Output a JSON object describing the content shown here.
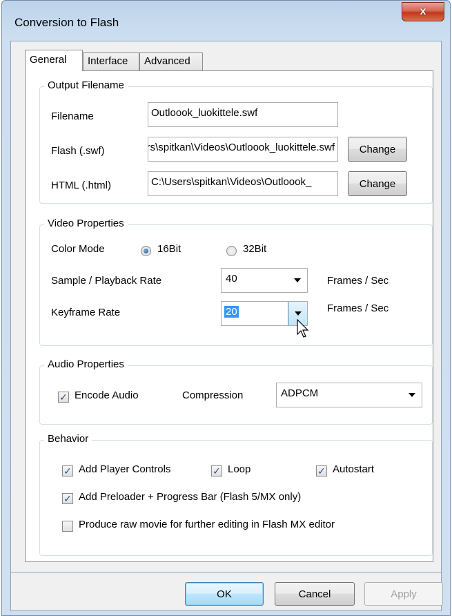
{
  "window": {
    "title": "Conversion to Flash",
    "close_glyph": "x"
  },
  "tabs": [
    {
      "label": "General",
      "active": true
    },
    {
      "label": "Interface",
      "active": false
    },
    {
      "label": "Advanced",
      "active": false
    }
  ],
  "output": {
    "group_title": "Output Filename",
    "filename_label": "Filename",
    "filename_value": "Outloook_luokittele.swf",
    "flash_label": "Flash (.swf)",
    "flash_value": "C:\\Users\\spitkan\\Videos\\Outloook_luokittele.swf",
    "html_label": "HTML (.html)",
    "html_value": "C:\\Users\\spitkan\\Videos\\Outloook_",
    "change_label": "Change"
  },
  "video": {
    "group_title": "Video Properties",
    "color_mode_label": "Color Mode",
    "option_16": "16Bit",
    "option_32": "32Bit",
    "selected": "16Bit",
    "sample_label": "Sample / Playback  Rate",
    "sample_value": "40",
    "keyframe_label": "Keyframe  Rate",
    "keyframe_value": "20",
    "fps_label": "Frames / Sec"
  },
  "audio": {
    "group_title": "Audio Properties",
    "encode_label": "Encode Audio",
    "encode_checked": true,
    "compression_label": "Compression",
    "compression_value": "ADPCM"
  },
  "behavior": {
    "group_title": "Behavior",
    "player_controls": "Add Player Controls",
    "loop": "Loop",
    "autostart": "Autostart",
    "preloader": "Add Preloader + Progress Bar  (Flash 5/MX only)",
    "raw_movie": "Produce raw movie for further editing in Flash MX editor",
    "checked_glyph": "✓"
  },
  "footer": {
    "ok": "OK",
    "cancel": "Cancel",
    "apply": "Apply"
  },
  "colors": {
    "accent": "#3399ff",
    "close": "#c2361d"
  }
}
